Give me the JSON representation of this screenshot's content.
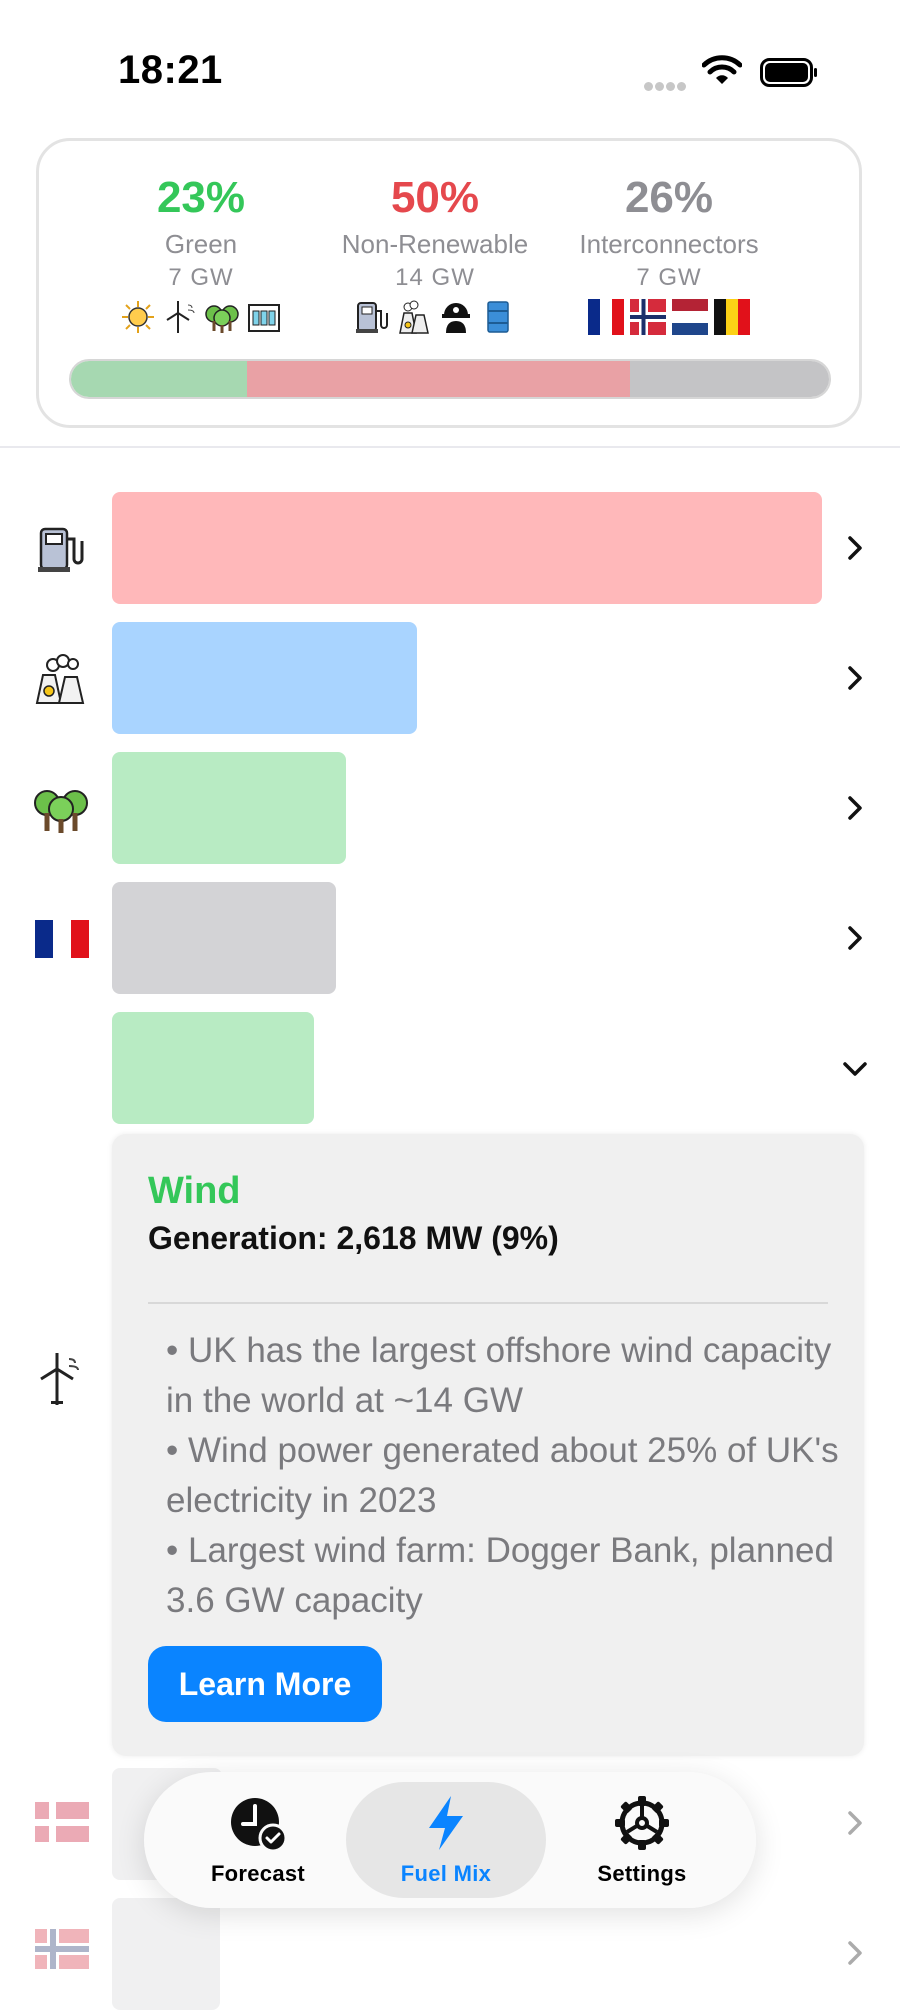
{
  "status_bar": {
    "time": "18:21"
  },
  "summary": {
    "green": {
      "percent": "23%",
      "label": "Green",
      "gw": "7 GW",
      "color": "#34c759",
      "share": 0.23,
      "icons": [
        "sun-icon",
        "wind-turbine-icon",
        "biomass-trees-icon",
        "hydro-dam-icon"
      ]
    },
    "non_renewable": {
      "percent": "50%",
      "label": "Non-Renewable",
      "gw": "14 GW",
      "color": "#e5484d",
      "share": 0.5,
      "icons": [
        "gas-pump-icon",
        "nuclear-plant-icon",
        "coal-miner-icon",
        "oil-barrel-icon"
      ]
    },
    "interconnectors": {
      "percent": "26%",
      "label": "Interconnectors",
      "gw": "7 GW",
      "color": "#8e8e93",
      "share": 0.26,
      "icons": [
        "flag-france-icon",
        "flag-norway-icon",
        "flag-netherlands-icon",
        "flag-belgium-icon"
      ]
    },
    "bar_colors": {
      "green": "#a6d8b1",
      "non_renewable": "#e9a1a5",
      "interconnectors": "#c4c4c6"
    }
  },
  "rows": [
    {
      "icon": "gas-pump-icon",
      "share": 1.0,
      "color": "#ffb8ba"
    },
    {
      "icon": "nuclear-plant-icon",
      "share": 0.43,
      "color": "#a9d4ff"
    },
    {
      "icon": "biomass-trees-icon",
      "share": 0.33,
      "color": "#b8ebc3"
    },
    {
      "icon": "flag-france-icon",
      "share": 0.315,
      "color": "#d3d3d6"
    },
    {
      "icon": "wind-turbine-icon",
      "share": 0.285,
      "color": "#b8ebc3",
      "expanded": true
    }
  ],
  "detail": {
    "title": "Wind",
    "generation": "Generation: 2,618 MW (9%)",
    "facts": [
      "• UK has the largest offshore wind capacity in the world at ~14 GW",
      "• Wind power generated about 25% of UK's electricity in 2023",
      "• Largest wind farm: Dogger Bank, planned 3.6 GW capacity"
    ],
    "button": "Learn More"
  },
  "tabs": [
    {
      "label": "Forecast",
      "icon": "clock-check-icon",
      "active": false
    },
    {
      "label": "Fuel Mix",
      "icon": "lightning-bolt-icon",
      "active": true
    },
    {
      "label": "Settings",
      "icon": "gear-icon",
      "active": false
    }
  ],
  "colors": {
    "accent": "#0a84ff",
    "green": "#34c759",
    "red": "#e5484d"
  }
}
